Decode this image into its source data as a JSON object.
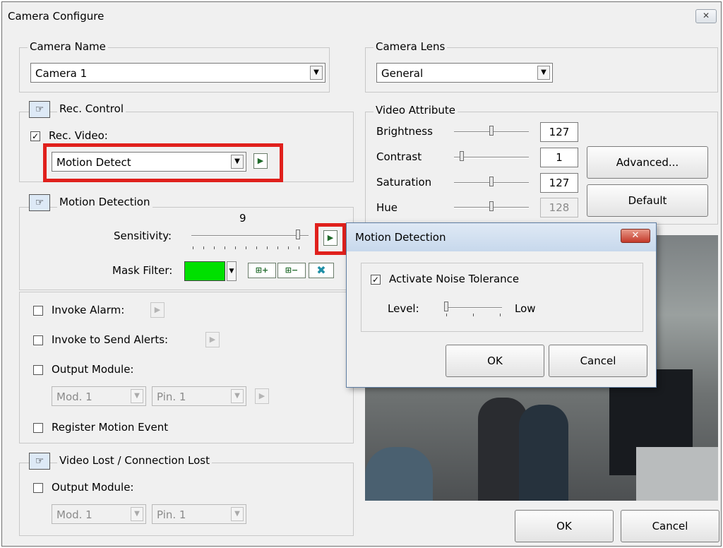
{
  "window": {
    "title": "Camera Configure",
    "close_glyph": "✕"
  },
  "camera_name": {
    "title": "Camera Name",
    "value": "Camera 1"
  },
  "camera_lens": {
    "title": "Camera Lens",
    "value": "General"
  },
  "rec_control": {
    "title": "Rec. Control",
    "rec_video_label": "Rec. Video:",
    "rec_video_checked": true,
    "mode_value": "Motion Detect"
  },
  "motion_detection": {
    "title": "Motion Detection",
    "sensitivity_label": "Sensitivity:",
    "sensitivity_value": "9",
    "mask_filter_label": "Mask Filter:",
    "mask_color": "#00e000"
  },
  "events": {
    "invoke_alarm": "Invoke Alarm:",
    "invoke_send_alerts": "Invoke to Send Alerts:",
    "output_module": "Output Module:",
    "mod_value": "Mod. 1",
    "pin_value": "Pin. 1",
    "register_motion_event": "Register Motion Event"
  },
  "video_lost": {
    "title": "Video Lost / Connection Lost",
    "output_module": "Output Module:",
    "mod_value": "Mod. 1",
    "pin_value": "Pin. 1"
  },
  "video_attribute": {
    "title": "Video Attribute",
    "brightness_label": "Brightness",
    "brightness_value": "127",
    "contrast_label": "Contrast",
    "contrast_value": "1",
    "saturation_label": "Saturation",
    "saturation_value": "127",
    "hue_label": "Hue",
    "hue_value": "128",
    "advanced_label": "Advanced...",
    "default_label": "Default"
  },
  "popup": {
    "title": "Motion Detection",
    "activate_label": "Activate Noise Tolerance",
    "activate_checked": true,
    "level_label": "Level:",
    "level_value": "Low",
    "ok_label": "OK",
    "cancel_label": "Cancel"
  },
  "footer": {
    "ok_label": "OK",
    "cancel_label": "Cancel"
  },
  "colors": {
    "highlight": "#e0201c",
    "accent": "#1f6a2a"
  },
  "icons": {
    "hand": "hand-point-icon",
    "play": "play-icon",
    "combo": "chevron-down-icon"
  }
}
